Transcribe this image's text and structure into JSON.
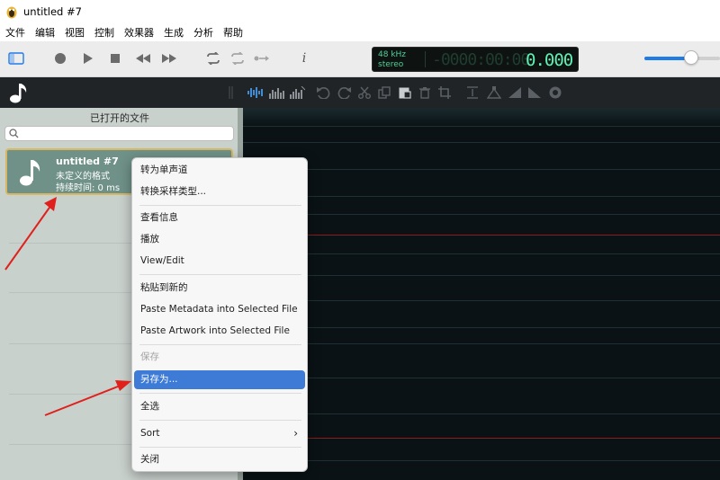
{
  "window": {
    "title": "untitled #7"
  },
  "menubar": [
    "文件",
    "编辑",
    "视图",
    "控制",
    "效果器",
    "生成",
    "分析",
    "帮助"
  ],
  "toolbar": {
    "lcd": {
      "sample_rate": "48 kHz",
      "channels": "stereo",
      "ghost_digits": "-0000:00:00",
      "time": "0.000"
    },
    "volume_level": 0.62,
    "info_label": "i"
  },
  "sidebar": {
    "header": "已打开的文件",
    "search_placeholder": "",
    "file": {
      "name": "untitled #7",
      "format": "未定义的格式",
      "duration": "持续时间: 0 ms"
    }
  },
  "context_menu": {
    "items": [
      {
        "label": "转为单声道",
        "state": "normal"
      },
      {
        "label": "转换采样类型...",
        "state": "normal"
      },
      {
        "label": "查看信息",
        "state": "normal"
      },
      {
        "label": "播放",
        "state": "normal"
      },
      {
        "label": "View/Edit",
        "state": "normal"
      },
      {
        "label": "粘贴到新的",
        "state": "normal"
      },
      {
        "label": "Paste Metadata into Selected File",
        "state": "normal"
      },
      {
        "label": "Paste Artwork into Selected File",
        "state": "normal"
      },
      {
        "label": "保存",
        "state": "disabled"
      },
      {
        "label": "另存为...",
        "state": "selected"
      },
      {
        "label": "全选",
        "state": "normal"
      },
      {
        "label": "Sort",
        "state": "submenu"
      },
      {
        "label": "关闭",
        "state": "normal"
      }
    ]
  },
  "colors": {
    "accent": "#3d7bd6",
    "lcd_text": "#5ef0b4",
    "file_card": "#6f9188",
    "annotation_arrow": "#e0201c"
  }
}
